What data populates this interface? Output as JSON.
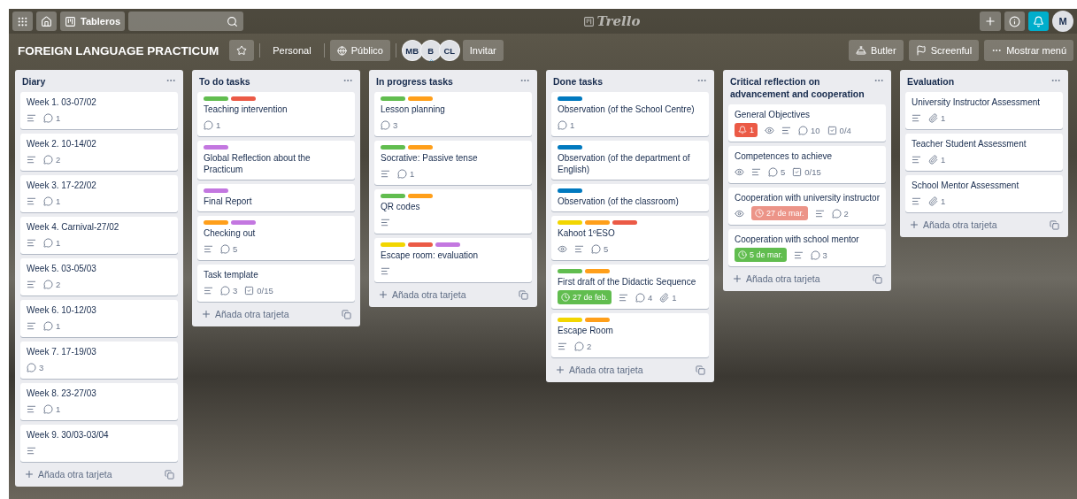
{
  "topbar": {
    "boards_button": "Tableros",
    "logo": "Trello",
    "notifications": {
      "active": true
    },
    "account": "M"
  },
  "board": {
    "title": "FOREIGN LANGUAGE PRACTICUM",
    "starred": false,
    "team": "Personal",
    "visibility": "Público",
    "members": [
      {
        "initials": "MB",
        "admin": false
      },
      {
        "initials": "B",
        "admin": true
      },
      {
        "initials": "CL",
        "admin": false
      }
    ],
    "invite": "Invitar",
    "actions": [
      {
        "kind": "butler",
        "label": "Butler"
      },
      {
        "kind": "powerup",
        "label": "Screenful"
      },
      {
        "kind": "menu",
        "label": "Mostrar menú"
      }
    ]
  },
  "lists": [
    {
      "title": "Diary",
      "add_card": "Añada otra tarjeta",
      "cards": [
        {
          "title": "Week 1. 03-07/02",
          "badges": [
            {
              "kind": "description"
            },
            {
              "kind": "comments",
              "text": "1"
            }
          ]
        },
        {
          "title": "Week 2. 10-14/02",
          "badges": [
            {
              "kind": "description"
            },
            {
              "kind": "comments",
              "text": "2"
            }
          ]
        },
        {
          "title": "Week 3. 17-22/02",
          "badges": [
            {
              "kind": "description"
            },
            {
              "kind": "comments",
              "text": "1"
            }
          ]
        },
        {
          "title": "Week 4. Carnival-27/02",
          "badges": [
            {
              "kind": "description"
            },
            {
              "kind": "comments",
              "text": "1"
            }
          ]
        },
        {
          "title": "Week 5. 03-05/03",
          "badges": [
            {
              "kind": "description"
            },
            {
              "kind": "comments",
              "text": "2"
            }
          ]
        },
        {
          "title": "Week 6. 10-12/03",
          "badges": [
            {
              "kind": "description"
            },
            {
              "kind": "comments",
              "text": "1"
            }
          ]
        },
        {
          "title": "Week 7. 17-19/03",
          "badges": [
            {
              "kind": "comments",
              "text": "3"
            }
          ]
        },
        {
          "title": "Week 8. 23-27/03",
          "badges": [
            {
              "kind": "description"
            },
            {
              "kind": "comments",
              "text": "1"
            }
          ]
        },
        {
          "title": "Week 9. 30/03-03/04",
          "badges": [
            {
              "kind": "description"
            }
          ]
        }
      ]
    },
    {
      "title": "To do tasks",
      "add_card": "Añada otra tarjeta",
      "cards": [
        {
          "title": "Teaching intervention",
          "labels": [
            {
              "color": "#61bd4f"
            },
            {
              "color": "#eb5a46"
            }
          ],
          "badges": [
            {
              "kind": "comments",
              "text": "1"
            }
          ]
        },
        {
          "title": "Global Reflection about the Practicum",
          "labels": [
            {
              "color": "#c377e0"
            }
          ]
        },
        {
          "title": "Final Report",
          "labels": [
            {
              "color": "#c377e0"
            }
          ]
        },
        {
          "title": "Checking out",
          "labels": [
            {
              "color": "#ff9f1a"
            },
            {
              "color": "#c377e0"
            }
          ],
          "badges": [
            {
              "kind": "description"
            },
            {
              "kind": "comments",
              "text": "5"
            }
          ]
        },
        {
          "title": "Task template",
          "badges": [
            {
              "kind": "description"
            },
            {
              "kind": "comments",
              "text": "3"
            },
            {
              "kind": "checklist",
              "text": "0/15"
            }
          ]
        }
      ]
    },
    {
      "title": "In progress tasks",
      "add_card": "Añada otra tarjeta",
      "cards": [
        {
          "title": "Lesson planning",
          "labels": [
            {
              "color": "#61bd4f"
            },
            {
              "color": "#ff9f1a"
            }
          ],
          "badges": [
            {
              "kind": "comments",
              "text": "3"
            }
          ]
        },
        {
          "title": "Socrative: Passive tense",
          "labels": [
            {
              "color": "#61bd4f"
            },
            {
              "color": "#ff9f1a"
            }
          ],
          "badges": [
            {
              "kind": "description"
            },
            {
              "kind": "comments",
              "text": "1"
            }
          ]
        },
        {
          "title": "QR codes",
          "labels": [
            {
              "color": "#61bd4f"
            },
            {
              "color": "#ff9f1a"
            }
          ],
          "badges": [
            {
              "kind": "description"
            }
          ]
        },
        {
          "title": "Escape room: evaluation",
          "labels": [
            {
              "color": "#f2d600"
            },
            {
              "color": "#eb5a46"
            },
            {
              "color": "#c377e0"
            }
          ],
          "badges": [
            {
              "kind": "description"
            }
          ]
        }
      ]
    },
    {
      "title": "Done tasks",
      "add_card": "Añada otra tarjeta",
      "cards": [
        {
          "title": "Observation (of the School Centre)",
          "labels": [
            {
              "color": "#0079bf"
            }
          ],
          "badges": [
            {
              "kind": "comments",
              "text": "1"
            }
          ]
        },
        {
          "title": "Observation (of the department of English)",
          "labels": [
            {
              "color": "#0079bf"
            }
          ]
        },
        {
          "title": "Observation (of the classroom)",
          "labels": [
            {
              "color": "#0079bf"
            }
          ]
        },
        {
          "title": "Kahoot 1ºESO",
          "labels": [
            {
              "color": "#f2d600"
            },
            {
              "color": "#ff9f1a"
            },
            {
              "color": "#eb5a46"
            }
          ],
          "badges": [
            {
              "kind": "watch"
            },
            {
              "kind": "description"
            },
            {
              "kind": "comments",
              "text": "5"
            }
          ]
        },
        {
          "title": "First draft of the Didactic Sequence",
          "labels": [
            {
              "color": "#61bd4f"
            },
            {
              "color": "#ff9f1a"
            }
          ],
          "badges": [
            {
              "kind": "due",
              "text": "27 de feb.",
              "color": "#61bd4f"
            },
            {
              "kind": "description"
            },
            {
              "kind": "comments",
              "text": "4"
            },
            {
              "kind": "attachments",
              "text": "1"
            }
          ]
        },
        {
          "title": "Escape Room",
          "labels": [
            {
              "color": "#f2d600"
            },
            {
              "color": "#ff9f1a"
            }
          ],
          "badges": [
            {
              "kind": "description"
            },
            {
              "kind": "comments",
              "text": "2"
            }
          ]
        }
      ]
    },
    {
      "title": "Critical reflection on advancement and cooperation",
      "add_card": "Añada otra tarjeta",
      "cards": [
        {
          "title": "General Objectives",
          "badges": [
            {
              "kind": "notification",
              "text": "1",
              "color": "#eb5a46"
            },
            {
              "kind": "watch"
            },
            {
              "kind": "description"
            },
            {
              "kind": "comments",
              "text": "10"
            },
            {
              "kind": "checklist",
              "text": "0/4"
            }
          ]
        },
        {
          "title": "Competences to achieve",
          "badges": [
            {
              "kind": "watch"
            },
            {
              "kind": "description"
            },
            {
              "kind": "comments",
              "text": "5"
            },
            {
              "kind": "checklist",
              "text": "0/15"
            }
          ]
        },
        {
          "title": "Cooperation with university instructor",
          "badges": [
            {
              "kind": "watch"
            },
            {
              "kind": "due",
              "text": "27 de mar.",
              "color": "#ec9488"
            },
            {
              "kind": "description"
            },
            {
              "kind": "comments",
              "text": "2"
            }
          ]
        },
        {
          "title": "Cooperation with school mentor",
          "badges": [
            {
              "kind": "due",
              "text": "5 de mar.",
              "color": "#61bd4f"
            },
            {
              "kind": "description"
            },
            {
              "kind": "comments",
              "text": "3"
            }
          ]
        }
      ]
    },
    {
      "title": "Evaluation",
      "add_card": "Añada otra tarjeta",
      "cards": [
        {
          "title": "University Instructor Assessment",
          "badges": [
            {
              "kind": "description"
            },
            {
              "kind": "attachments",
              "text": "1"
            }
          ]
        },
        {
          "title": "Teacher Student Assessment",
          "badges": [
            {
              "kind": "description"
            },
            {
              "kind": "attachments",
              "text": "1"
            }
          ]
        },
        {
          "title": "School Mentor Assessment",
          "badges": [
            {
              "kind": "description"
            },
            {
              "kind": "attachments",
              "text": "1"
            }
          ]
        }
      ]
    }
  ]
}
